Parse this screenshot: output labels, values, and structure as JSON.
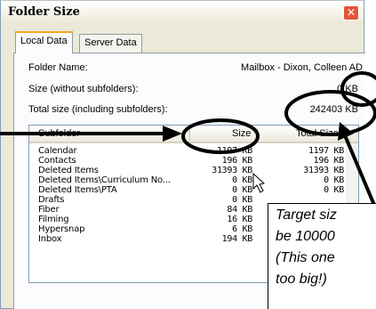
{
  "window": {
    "title": "Folder Size",
    "close_glyph": "✕"
  },
  "tabs": [
    {
      "label": "Local Data",
      "active": true
    },
    {
      "label": "Server Data",
      "active": false
    }
  ],
  "info": {
    "folder_name_label": "Folder Name:",
    "folder_name_value": "Mailbox - Dixon, Colleen   AD",
    "size_label": "Size (without subfolders):",
    "size_value": "0 KB",
    "total_label": "Total size (including subfolders):",
    "total_value": "242403 KB"
  },
  "table": {
    "columns": [
      "Subfolder",
      "Size",
      "Total Size"
    ],
    "rows": [
      {
        "name": "Calendar",
        "size": "1197 KB",
        "total": "1197 KB"
      },
      {
        "name": "Contacts",
        "size": "196 KB",
        "total": "196 KB"
      },
      {
        "name": "Deleted Items",
        "size": "31393 KB",
        "total": "31393 KB"
      },
      {
        "name": "Deleted Items\\Curriculum No...",
        "size": "0 KB",
        "total": "0 KB"
      },
      {
        "name": "Deleted Items\\PTA",
        "size": "0 KB",
        "total": "0 KB"
      },
      {
        "name": "Drafts",
        "size": "0 KB",
        "total": ""
      },
      {
        "name": "Fiber",
        "size": "84 KB",
        "total": ""
      },
      {
        "name": "Filming",
        "size": "16 KB",
        "total": ""
      },
      {
        "name": "Hypersnap",
        "size": "6 KB",
        "total": ""
      },
      {
        "name": "Inbox",
        "size": "194 KB",
        "total": ""
      }
    ]
  },
  "callout": {
    "lines": [
      "Target siz",
      "be 10000",
      "(This one",
      "too big!)"
    ]
  },
  "colors": {
    "title_bar": "#ffffff",
    "close_button": "#e4543c",
    "window_bg": "#ece9d8"
  },
  "icons": {
    "close": "close-icon",
    "cursor": "cursor-arrow-icon"
  }
}
